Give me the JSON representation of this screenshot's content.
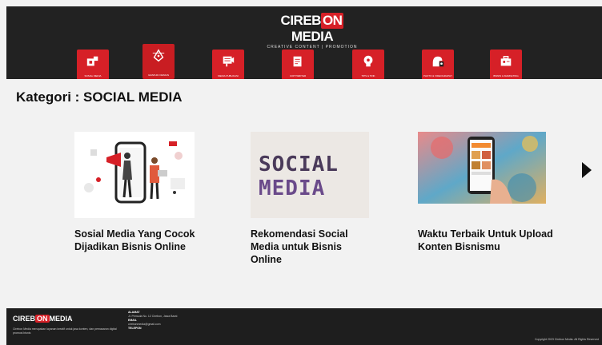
{
  "header": {
    "logo_left": "CIREB",
    "logo_mid": "ON",
    "logo_right": "MEDIA",
    "tagline": "CREATIVE CONTENT | PROMOTION"
  },
  "categories": [
    {
      "label": "Sosial Media",
      "icon": "social-media-icon"
    },
    {
      "label": "Graphic Design",
      "icon": "pen-tool-icon"
    },
    {
      "label": "Media Publikasi",
      "icon": "billboard-icon"
    },
    {
      "label": "Copywriter",
      "icon": "document-edit-icon"
    },
    {
      "label": "Tips & Trik",
      "icon": "lightbulb-head-icon"
    },
    {
      "label": "Photo & Videography",
      "icon": "camera-person-icon"
    },
    {
      "label": "Bisnis & Marketing",
      "icon": "briefcase-icon"
    }
  ],
  "main": {
    "title": "Kategori : SOCIAL MEDIA",
    "articles": [
      {
        "title": "Sosial Media Yang Cocok Dijadikan Bisnis Online"
      },
      {
        "title": "Rekomendasi Social Media untuk Bisnis Online",
        "thumb_text_1": "SOCIAL",
        "thumb_text_2": "MEDIA"
      },
      {
        "title": "Waktu Terbaik Untuk Upload Konten Bisnismu"
      }
    ]
  },
  "footer": {
    "logo_left": "CIREB",
    "logo_mid": "ON",
    "logo_right": "MEDIA",
    "description": "Cirebon Media merupakan layanan kreatif untuk jasa konten, dan pemasaran digital promosi bisnis",
    "alamat_label": "ALAMAT",
    "alamat_value": "Jl. Pemuda No. 12 Cirebon, Jawa Barat",
    "email_label": "EMAIL",
    "email_value": "cirebonmedia@gmail.com",
    "telepon_label": "TELEPON",
    "copyright": "Copyright 2023 Cirebon Media. All Rights Reserved"
  },
  "colors": {
    "brand_red": "#d62027",
    "header_bg": "#222222",
    "footer_bg": "#1e1e1e"
  }
}
